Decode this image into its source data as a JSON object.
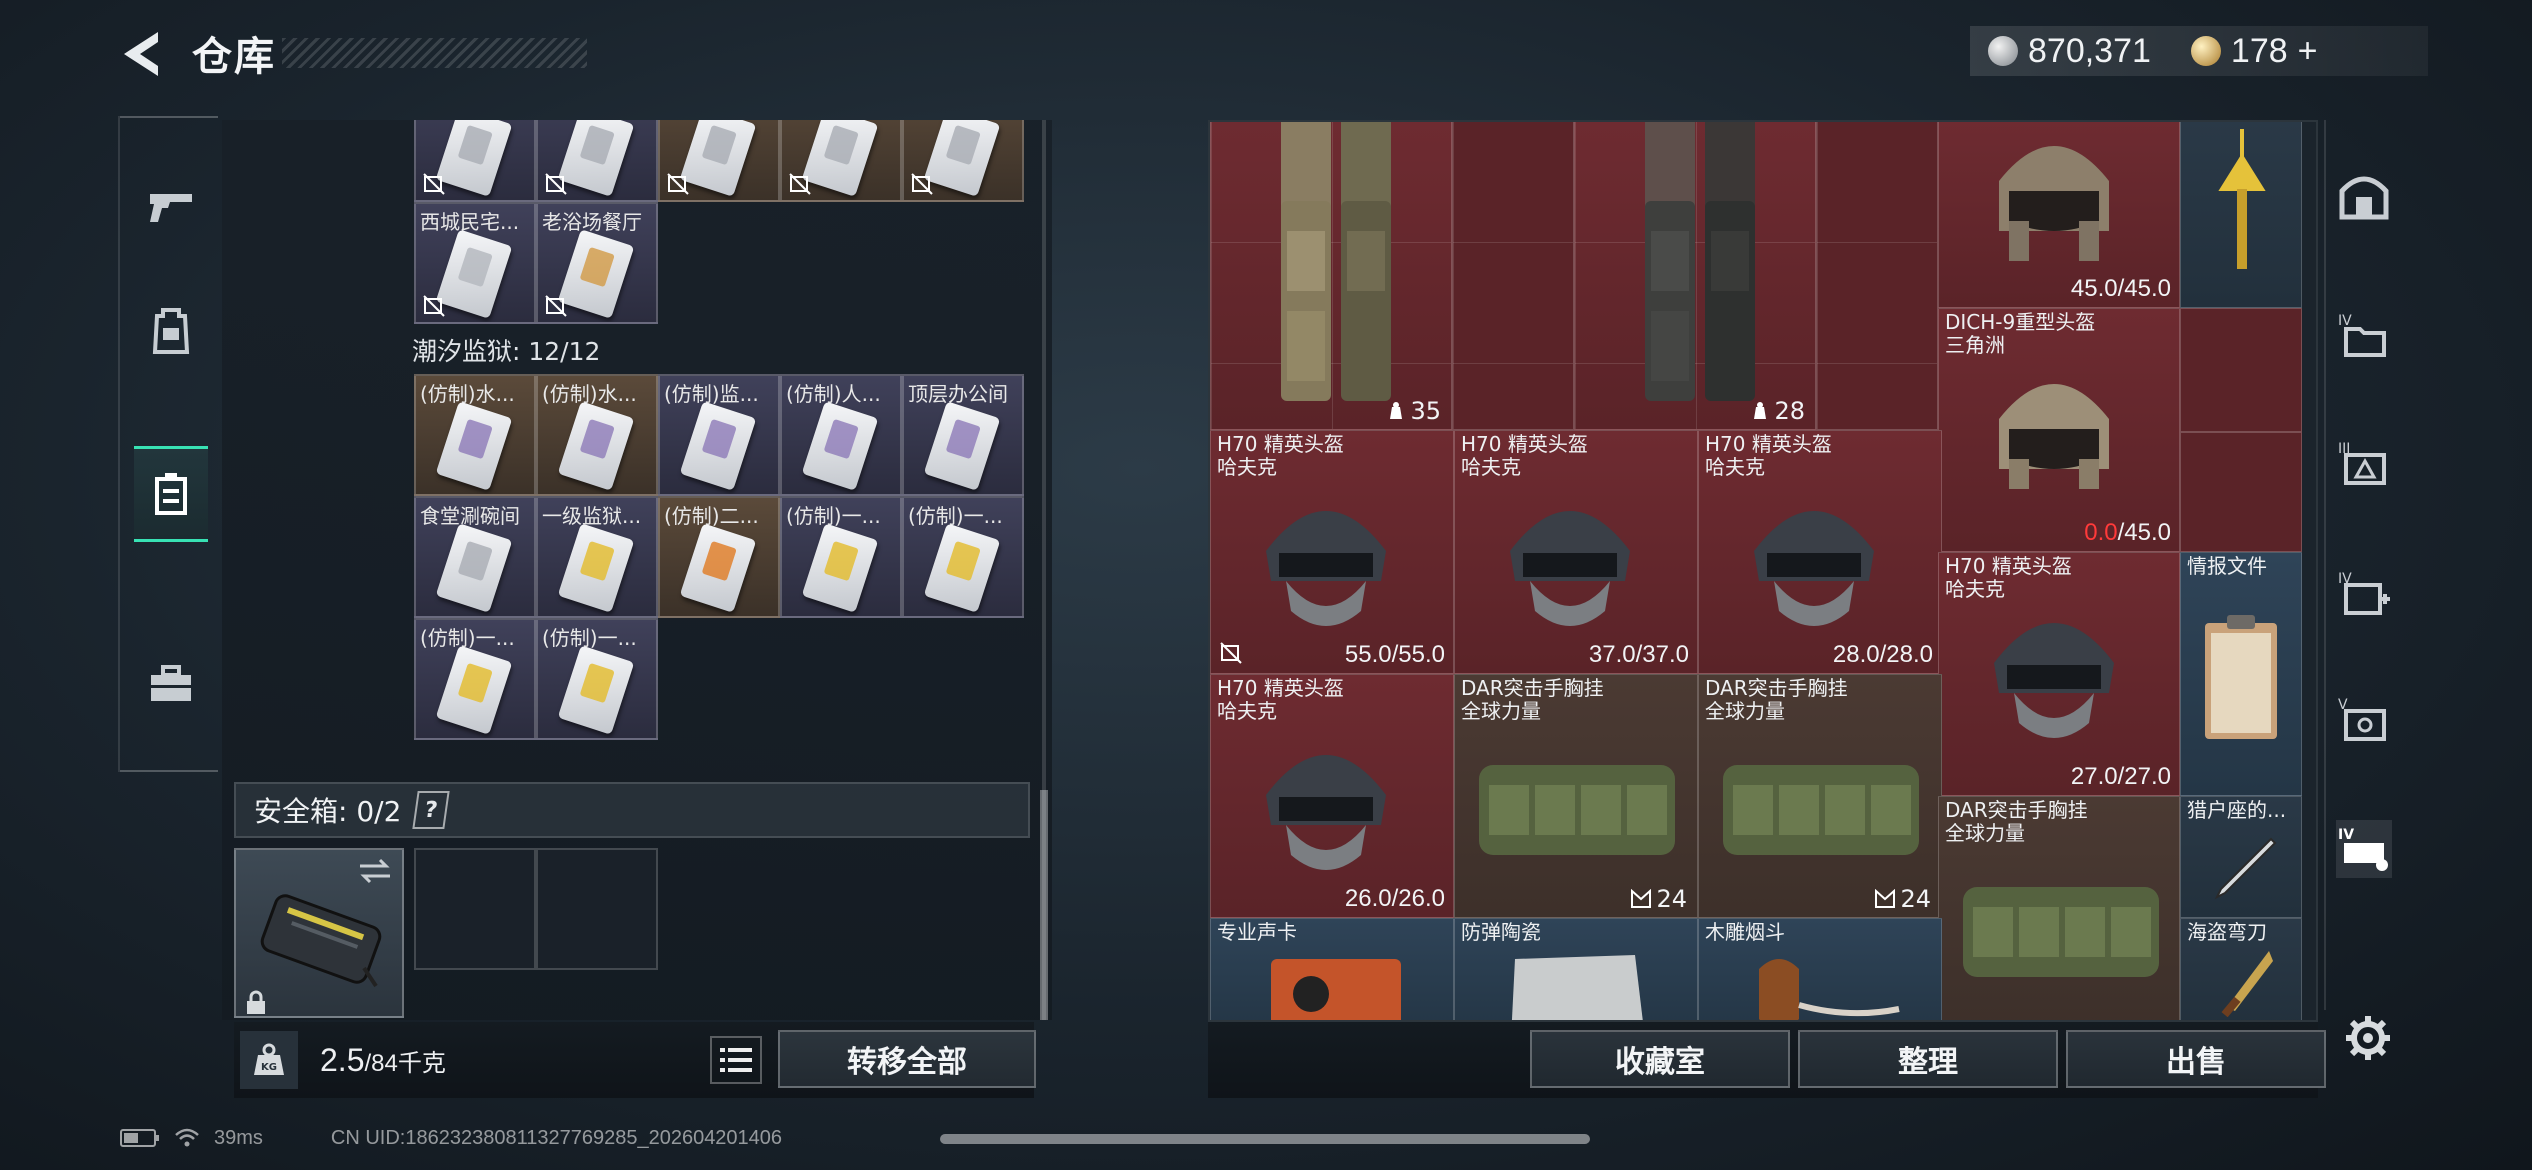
{
  "header": {
    "title": "仓库",
    "currency_silver": "870,371",
    "currency_gold": "178"
  },
  "left_nav": {
    "items": [
      {
        "name": "weapons",
        "icon": "pistol-icon"
      },
      {
        "name": "backpack",
        "icon": "backpack-icon"
      },
      {
        "name": "keys",
        "icon": "keycard-icon",
        "active": true
      },
      {
        "name": "toolbox",
        "icon": "toolbox-icon"
      }
    ]
  },
  "key_section": {
    "top_row_names": [
      "西城民宅...",
      "老浴场餐厅"
    ],
    "section_label": "潮汐监狱: 12/12",
    "row1": [
      "(仿制)水...",
      "(仿制)水...",
      "(仿制)监...",
      "(仿制)人...",
      "顶层办公间"
    ],
    "row2": [
      "食堂涮碗间",
      "一级监狱...",
      "(仿制)二...",
      "(仿制)一...",
      "(仿制)一..."
    ],
    "row3": [
      "(仿制)一...",
      "(仿制)一..."
    ]
  },
  "safe_box": {
    "label": "安全箱: 0/2",
    "help": "?"
  },
  "weight": {
    "current": "2.5",
    "max": "/84千克",
    "transfer_all": "转移全部"
  },
  "stash": {
    "vest1_count": "35",
    "vest2_count": "28",
    "helmet_top_durability": "45.0/45.0",
    "dich_name_line1": "DICH-9重型头盔",
    "dich_name_line2": "三角洲",
    "dich_durability_current": "0.0",
    "dich_durability_max": "/45.0",
    "h70_1": {
      "line1": "H70 精英头盔",
      "line2": "哈夫克",
      "dur": "55.0/55.0"
    },
    "h70_2": {
      "line1": "H70 精英头盔",
      "line2": "哈夫克",
      "dur": "37.0/37.0"
    },
    "h70_3": {
      "line1": "H70 精英头盔",
      "line2": "哈夫克",
      "dur": "28.0/28.0"
    },
    "h70_4": {
      "line1": "H70 精英头盔",
      "line2": "哈夫克",
      "dur": "27.0/27.0"
    },
    "h70_5": {
      "line1": "H70 精英头盔",
      "line2": "哈夫克",
      "dur": "26.0/26.0"
    },
    "intel_file": "情报文件",
    "dar1": {
      "line1": "DAR突击手胸挂",
      "line2": "全球力量",
      "count": "24"
    },
    "dar2": {
      "line1": "DAR突击手胸挂",
      "line2": "全球力量",
      "count": "24"
    },
    "dar3": {
      "line1": "DAR突击手胸挂",
      "line2": "全球力量"
    },
    "hunter_item": "猎户座的...",
    "sound_card": "专业声卡",
    "ceramic": "防弹陶瓷",
    "pipe": "木雕烟斗",
    "pirate_knife": "海盗弯刀"
  },
  "bottom_buttons": {
    "collection": "收藏室",
    "sort": "整理",
    "sell": "出售"
  },
  "status": {
    "ping": "39ms",
    "uid": "CN UID:186232380811327769285_202604201406"
  },
  "colors": {
    "accent": "#38e2b4",
    "red_rarity": "#6e2b31",
    "durability_warning": "#ff3a3a"
  }
}
